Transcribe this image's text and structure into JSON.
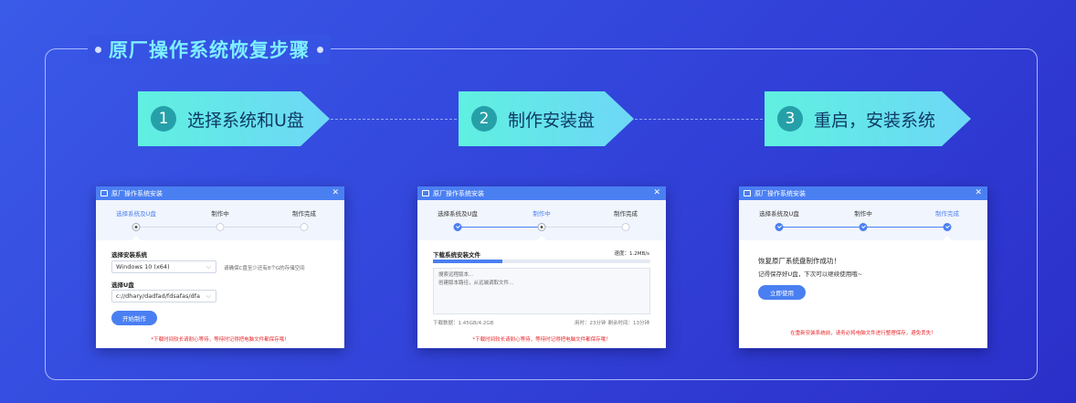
{
  "header": {
    "title": "原厂操作系统恢复步骤"
  },
  "steps": [
    {
      "number": "1",
      "label": "选择系统和U盘"
    },
    {
      "number": "2",
      "label": "制作安装盘"
    },
    {
      "number": "3",
      "label": "重启，安装系统"
    }
  ],
  "window_title": "原厂操作系统安装",
  "progress_labels": [
    "选择系统及U盘",
    "制作中",
    "制作完成"
  ],
  "win1": {
    "os_label": "选择安装系统",
    "os_value": "Windows 10 (x64)",
    "os_hint": "请确保C盘至少还有8个G的存储空间",
    "usb_label": "选择U盘",
    "usb_value": "c://dhary/dadfad/fdsafas/dfa",
    "start_button": "开始制作",
    "warning": "*下载时间较长请耐心等待，等待时记得把电脑文件都保存哦！"
  },
  "win2": {
    "download_label": "下载系统安装文件",
    "speed": "速度：1.2MB/s",
    "progress": 0.32,
    "log_lines": [
      "搜索远程版本...",
      "创建版本路径，从远端调取文件..."
    ],
    "downloaded": "下载数据：1.45GB/4.2GB",
    "elapsed": "用时：23分钟",
    "remaining": "剩余时间：13分钟",
    "warning": "*下载时间较长请耐心等待，等待时记得把电脑文件都保存哦！"
  },
  "win3": {
    "success_title": "恢复原厂系统盘制作成功！",
    "success_sub": "记得保存好U盘，下次可以继续使用哦~",
    "use_button": "立即使用",
    "warning": "在重新安装系统前，请务必将电脑文件进行整理保存，避免丢失！"
  },
  "colors": {
    "accent": "#4a7ff2",
    "title": "#7ef0ff",
    "warning": "#e8262b"
  }
}
